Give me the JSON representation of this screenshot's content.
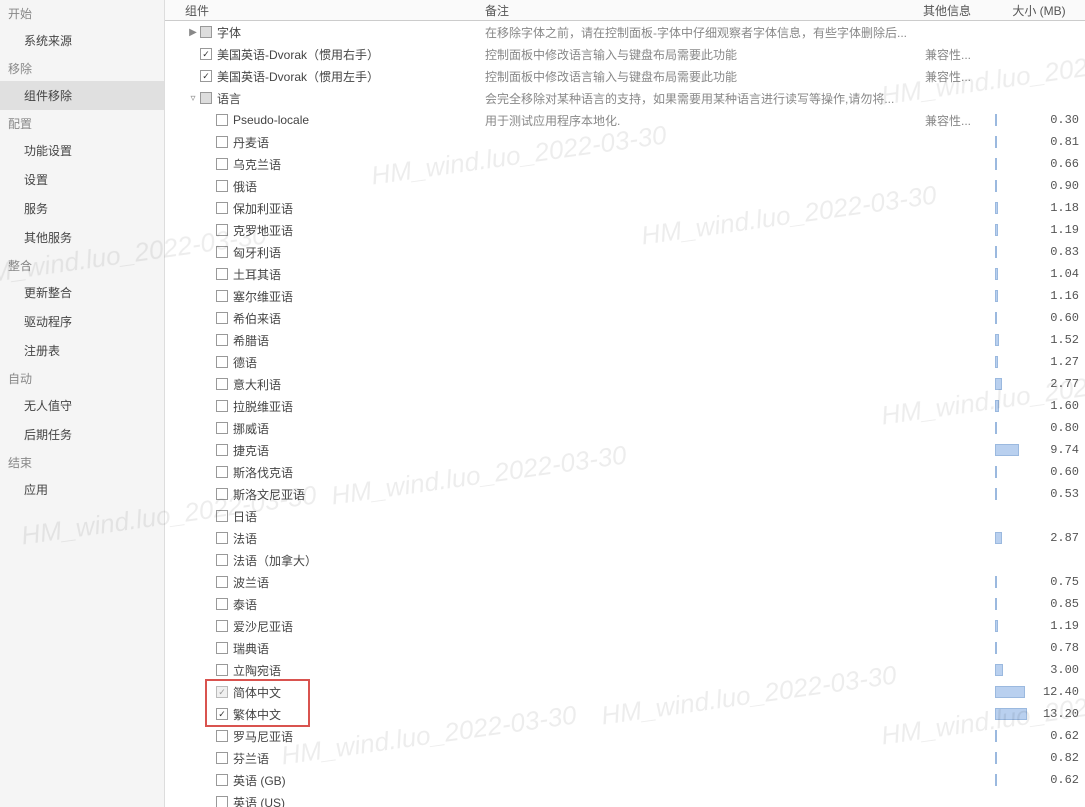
{
  "sidebar": {
    "groups": [
      {
        "label": "开始",
        "items": [
          {
            "label": "系统来源"
          }
        ]
      },
      {
        "label": "移除",
        "items": [
          {
            "label": "组件移除",
            "active": true
          }
        ]
      },
      {
        "label": "配置",
        "items": [
          {
            "label": "功能设置"
          },
          {
            "label": "设置"
          },
          {
            "label": "服务"
          },
          {
            "label": "其他服务"
          }
        ]
      },
      {
        "label": "整合",
        "items": [
          {
            "label": "更新整合"
          },
          {
            "label": "驱动程序"
          },
          {
            "label": "注册表"
          }
        ]
      },
      {
        "label": "自动",
        "items": [
          {
            "label": "无人值守"
          },
          {
            "label": "后期任务"
          }
        ]
      },
      {
        "label": "结束",
        "items": [
          {
            "label": "应用"
          }
        ]
      }
    ]
  },
  "columns": {
    "component": "组件",
    "note": "备注",
    "other": "其他信息",
    "size": "大小 (MB)"
  },
  "rows": [
    {
      "indent": 0,
      "expand": "▶",
      "cb": "mixed",
      "label": "字体",
      "note": "在移除字体之前，请在控制面板-字体中仔细观察者字体信息，有些字体删除后...",
      "other": "",
      "size": ""
    },
    {
      "indent": 0,
      "expand": "",
      "cb": "checked",
      "label": "美国英语-Dvorak（惯用右手）",
      "note": "控制面板中修改语言输入与键盘布局需要此功能",
      "other": "兼容性...",
      "size": ""
    },
    {
      "indent": 0,
      "expand": "",
      "cb": "checked",
      "label": "美国英语-Dvorak（惯用左手）",
      "note": "控制面板中修改语言输入与键盘布局需要此功能",
      "other": "兼容性...",
      "size": ""
    },
    {
      "indent": 0,
      "expand": "▿",
      "cb": "mixed",
      "label": "语言",
      "note": "会完全移除对某种语言的支持，如果需要用某种语言进行读写等操作,请勿将...",
      "other": "",
      "size": ""
    },
    {
      "indent": 1,
      "expand": "",
      "cb": "unchecked",
      "label": "Pseudo-locale",
      "note": "用于测试应用程序本地化.",
      "other": "兼容性...",
      "size": "0.30",
      "bar": 1
    },
    {
      "indent": 1,
      "expand": "",
      "cb": "unchecked",
      "label": "丹麦语",
      "note": "",
      "other": "",
      "size": "0.81",
      "bar": 2
    },
    {
      "indent": 1,
      "expand": "",
      "cb": "unchecked",
      "label": "乌克兰语",
      "note": "",
      "other": "",
      "size": "0.66",
      "bar": 2
    },
    {
      "indent": 1,
      "expand": "",
      "cb": "unchecked",
      "label": "俄语",
      "note": "",
      "other": "",
      "size": "0.90",
      "bar": 2
    },
    {
      "indent": 1,
      "expand": "",
      "cb": "unchecked",
      "label": "保加利亚语",
      "note": "",
      "other": "",
      "size": "1.18",
      "bar": 3
    },
    {
      "indent": 1,
      "expand": "",
      "cb": "unchecked",
      "label": "克罗地亚语",
      "note": "",
      "other": "",
      "size": "1.19",
      "bar": 3
    },
    {
      "indent": 1,
      "expand": "",
      "cb": "unchecked",
      "label": "匈牙利语",
      "note": "",
      "other": "",
      "size": "0.83",
      "bar": 2
    },
    {
      "indent": 1,
      "expand": "",
      "cb": "unchecked",
      "label": "土耳其语",
      "note": "",
      "other": "",
      "size": "1.04",
      "bar": 3
    },
    {
      "indent": 1,
      "expand": "",
      "cb": "unchecked",
      "label": "塞尔维亚语",
      "note": "",
      "other": "",
      "size": "1.16",
      "bar": 3
    },
    {
      "indent": 1,
      "expand": "",
      "cb": "unchecked",
      "label": "希伯来语",
      "note": "",
      "other": "",
      "size": "0.60",
      "bar": 2
    },
    {
      "indent": 1,
      "expand": "",
      "cb": "unchecked",
      "label": "希腊语",
      "note": "",
      "other": "",
      "size": "1.52",
      "bar": 4
    },
    {
      "indent": 1,
      "expand": "",
      "cb": "unchecked",
      "label": "德语",
      "note": "",
      "other": "",
      "size": "1.27",
      "bar": 3
    },
    {
      "indent": 1,
      "expand": "",
      "cb": "unchecked",
      "label": "意大利语",
      "note": "",
      "other": "",
      "size": "2.77",
      "bar": 7
    },
    {
      "indent": 1,
      "expand": "",
      "cb": "unchecked",
      "label": "拉脱维亚语",
      "note": "",
      "other": "",
      "size": "1.60",
      "bar": 4
    },
    {
      "indent": 1,
      "expand": "",
      "cb": "unchecked",
      "label": "挪威语",
      "note": "",
      "other": "",
      "size": "0.80",
      "bar": 2
    },
    {
      "indent": 1,
      "expand": "",
      "cb": "unchecked",
      "label": "捷克语",
      "note": "",
      "other": "",
      "size": "9.74",
      "bar": 24
    },
    {
      "indent": 1,
      "expand": "",
      "cb": "unchecked",
      "label": "斯洛伐克语",
      "note": "",
      "other": "",
      "size": "0.60",
      "bar": 2
    },
    {
      "indent": 1,
      "expand": "",
      "cb": "unchecked",
      "label": "斯洛文尼亚语",
      "note": "",
      "other": "",
      "size": "0.53",
      "bar": 2
    },
    {
      "indent": 1,
      "expand": "",
      "cb": "unchecked",
      "label": "日语",
      "note": "",
      "other": "",
      "size": "",
      "bar": 0
    },
    {
      "indent": 1,
      "expand": "",
      "cb": "unchecked",
      "label": "法语",
      "note": "",
      "other": "",
      "size": "2.87",
      "bar": 7
    },
    {
      "indent": 1,
      "expand": "",
      "cb": "unchecked",
      "label": "法语（加拿大）",
      "note": "",
      "other": "",
      "size": "",
      "bar": 0
    },
    {
      "indent": 1,
      "expand": "",
      "cb": "unchecked",
      "label": "波兰语",
      "note": "",
      "other": "",
      "size": "0.75",
      "bar": 2
    },
    {
      "indent": 1,
      "expand": "",
      "cb": "unchecked",
      "label": "泰语",
      "note": "",
      "other": "",
      "size": "0.85",
      "bar": 2
    },
    {
      "indent": 1,
      "expand": "",
      "cb": "unchecked",
      "label": "爱沙尼亚语",
      "note": "",
      "other": "",
      "size": "1.19",
      "bar": 3
    },
    {
      "indent": 1,
      "expand": "",
      "cb": "unchecked",
      "label": "瑞典语",
      "note": "",
      "other": "",
      "size": "0.78",
      "bar": 2
    },
    {
      "indent": 1,
      "expand": "",
      "cb": "unchecked",
      "label": "立陶宛语",
      "note": "",
      "other": "",
      "size": "3.00",
      "bar": 8
    },
    {
      "indent": 1,
      "expand": "",
      "cb": "checked-disabled",
      "label": "简体中文",
      "note": "",
      "other": "",
      "size": "12.40",
      "bar": 30,
      "hl": true
    },
    {
      "indent": 1,
      "expand": "",
      "cb": "checked",
      "label": "繁体中文",
      "note": "",
      "other": "",
      "size": "13.20",
      "bar": 32,
      "hl": true
    },
    {
      "indent": 1,
      "expand": "",
      "cb": "unchecked",
      "label": "罗马尼亚语",
      "note": "",
      "other": "",
      "size": "0.62",
      "bar": 2
    },
    {
      "indent": 1,
      "expand": "",
      "cb": "unchecked",
      "label": "芬兰语",
      "note": "",
      "other": "",
      "size": "0.82",
      "bar": 2
    },
    {
      "indent": 1,
      "expand": "",
      "cb": "unchecked",
      "label": "英语 (GB)",
      "note": "",
      "other": "",
      "size": "0.62",
      "bar": 2
    },
    {
      "indent": 1,
      "expand": "",
      "cb": "unchecked",
      "label": "英语 (US)",
      "note": "",
      "other": "",
      "size": "",
      "bar": 0
    }
  ],
  "watermark": "HM_wind.luo_2022-03-30"
}
